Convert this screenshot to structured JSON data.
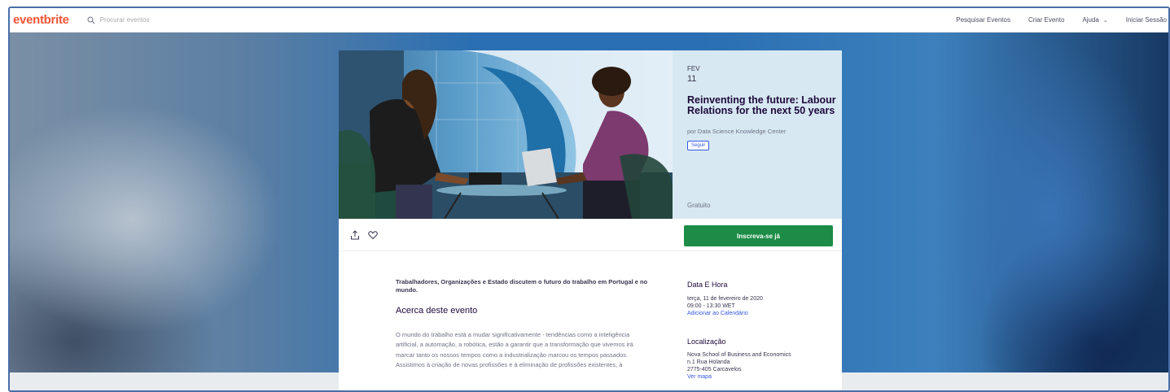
{
  "header": {
    "logo": "eventbrite",
    "search_placeholder": "Procurar eventos",
    "nav": {
      "search_events": "Pesquisar Eventos",
      "create_event": "Criar Evento",
      "help": "Ajuda",
      "sign_in": "Iniciar Sessão"
    }
  },
  "event": {
    "month": "FEV",
    "day": "11",
    "title": "Reinventing the future: Labour Relations for the next 50 years",
    "organizer": "por Data Science Knowledge Center",
    "follow_label": "Seguir",
    "price": "Gratuito",
    "register_label": "Inscreva-se já"
  },
  "details": {
    "summary": "Trabalhadores, Organizações e Estado discutem o futuro do trabalho em Portugal e no mundo.",
    "about_heading": "Acerca deste evento",
    "about_text": "O mundo do trabalho está a mudar significativamente - tendências como a inteligência artificial, a automação, a robótica, estão a garantir que a transformação que vivemos irá marcar tanto os nossos tempos como a industrialização marcou os tempos passados. Assistimos à criação de novas profissões e à eliminação de profissões existentes, à"
  },
  "aside": {
    "date_heading": "Data E Hora",
    "date_line": "terça, 11 de fevereiro de 2020",
    "time_line": "09:00 - 13:30 WET",
    "add_calendar": "Adicionar ao Calendário",
    "location_heading": "Localização",
    "venue": "Nova School of Business and Economics",
    "address1": "n.1 Rua Holanda",
    "address2": "2775-405 Carcavelos",
    "map_link": "Ver mapa"
  },
  "colors": {
    "brand": "#f05537",
    "register": "#1d8c46",
    "link": "#3659e3",
    "panel": "#d7e8f2"
  },
  "icons": [
    "search-icon",
    "share-icon",
    "heart-icon",
    "chevron-down-icon"
  ]
}
